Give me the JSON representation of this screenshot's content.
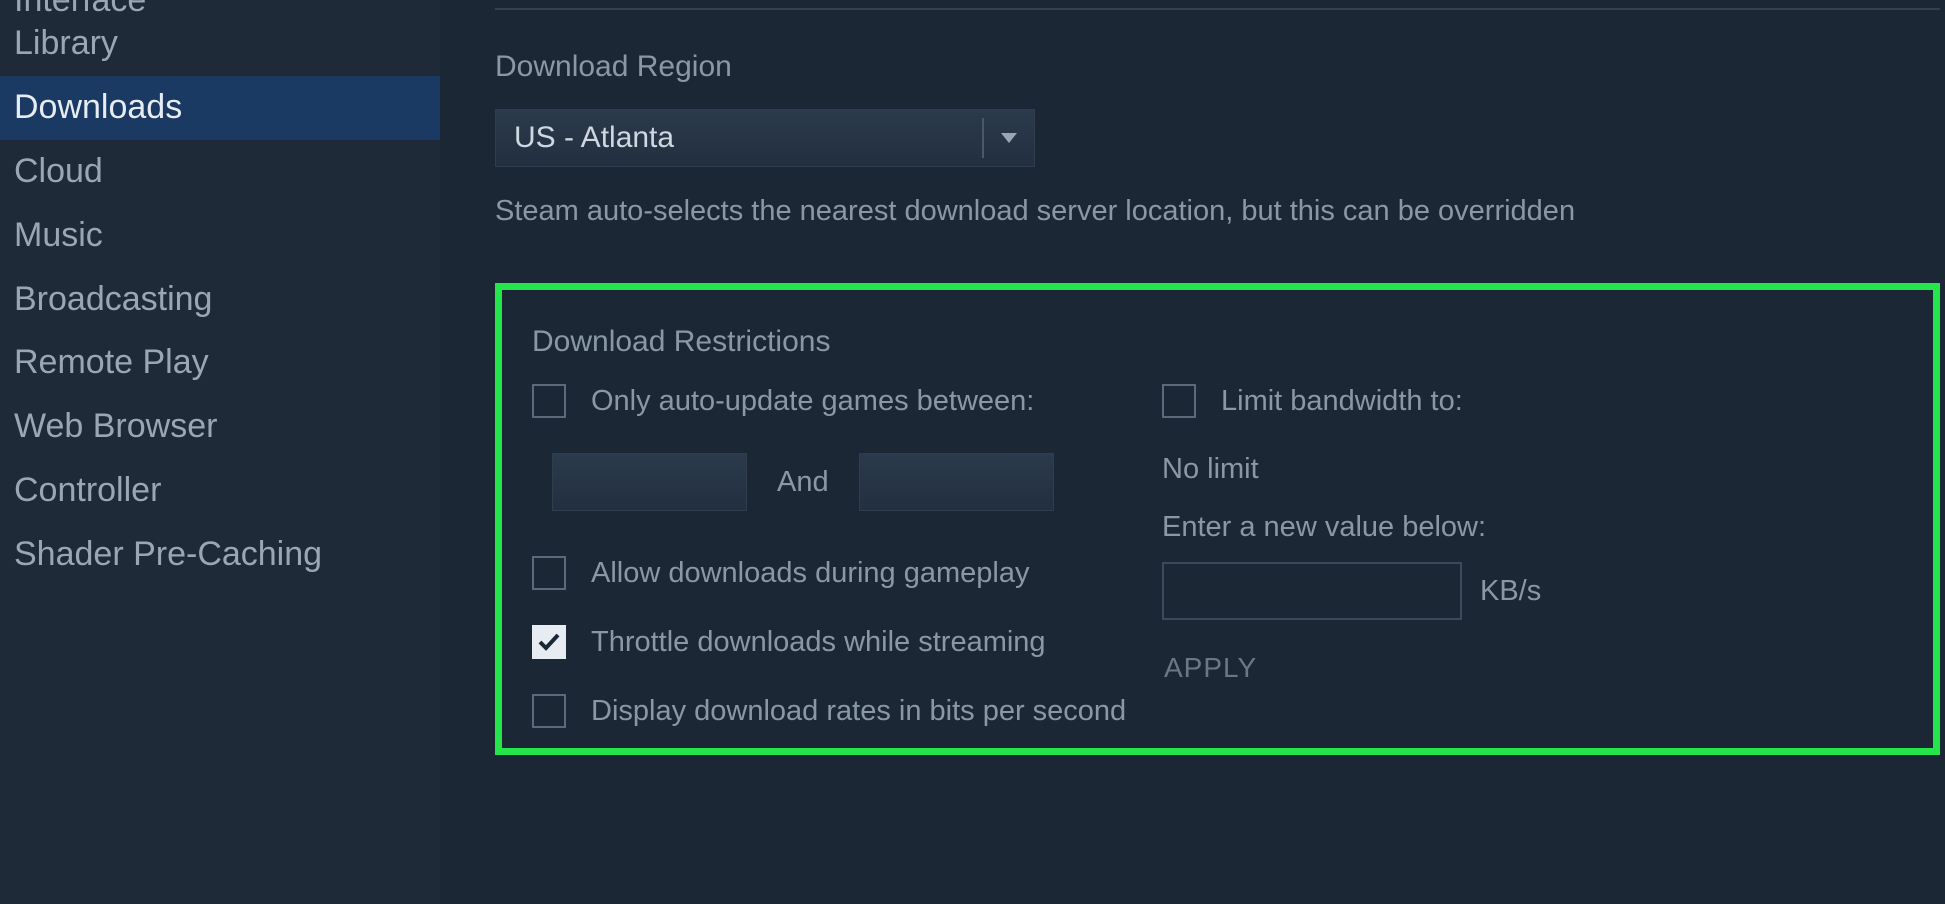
{
  "sidebar": {
    "items": [
      {
        "label": "Interface",
        "active": false,
        "cutoff": true
      },
      {
        "label": "Library",
        "active": false
      },
      {
        "label": "Downloads",
        "active": true
      },
      {
        "label": "Cloud",
        "active": false
      },
      {
        "label": "Music",
        "active": false
      },
      {
        "label": "Broadcasting",
        "active": false
      },
      {
        "label": "Remote Play",
        "active": false
      },
      {
        "label": "Web Browser",
        "active": false
      },
      {
        "label": "Controller",
        "active": false
      },
      {
        "label": "Shader Pre-Caching",
        "active": false
      }
    ]
  },
  "region": {
    "title": "Download Region",
    "selected": "US - Atlanta",
    "help": "Steam auto-selects the nearest download server location, but this can be overridden"
  },
  "restrictions": {
    "title": "Download Restrictions",
    "auto_update_label": "Only auto-update games between:",
    "and_label": "And",
    "allow_during_gameplay_label": "Allow downloads during gameplay",
    "throttle_streaming_label": "Throttle downloads while streaming",
    "display_bits_label": "Display download rates in bits per second",
    "limit_bandwidth_label": "Limit bandwidth to:",
    "no_limit_text": "No limit",
    "enter_value_text": "Enter a new value below:",
    "unit": "KB/s",
    "apply_label": "APPLY",
    "checks": {
      "auto_update": false,
      "allow_during_gameplay": false,
      "throttle_streaming": true,
      "display_bits": false,
      "limit_bandwidth": false
    },
    "time_from": "",
    "time_to": "",
    "bandwidth_value": ""
  }
}
